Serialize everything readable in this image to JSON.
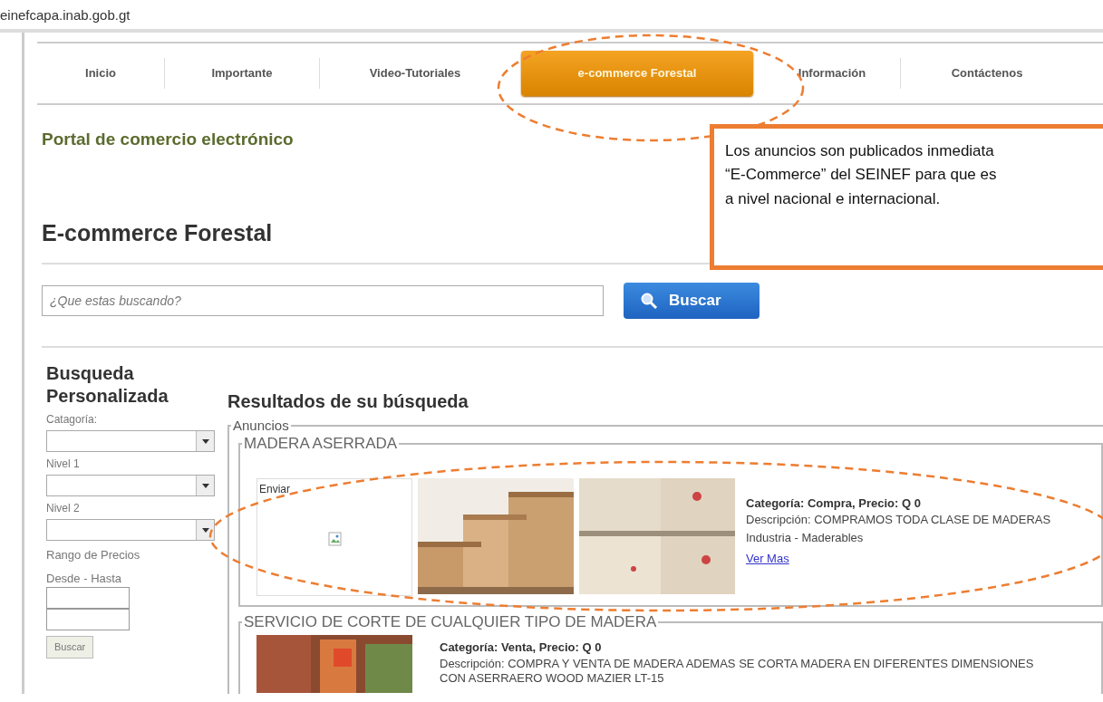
{
  "address_bar": {
    "url": "einefcapa.inab.gob.gt"
  },
  "nav": {
    "tabs": [
      {
        "label": "Inicio",
        "selected": false
      },
      {
        "label": "Importante",
        "selected": false
      },
      {
        "label": "Video-Tutoriales",
        "selected": false
      },
      {
        "label": "e-commerce Forestal",
        "selected": true
      },
      {
        "label": "Información",
        "selected": false
      },
      {
        "label": "Contáctenos",
        "selected": false
      }
    ]
  },
  "portal_title": "Portal de comercio electrónico",
  "page_title": "E-commerce Forestal",
  "search": {
    "placeholder": "¿Que estas buscando?",
    "button": "Buscar"
  },
  "filters": {
    "title": "Busqueda Personalizada",
    "items": [
      {
        "kind": "select",
        "label": "Catagoría:"
      },
      {
        "kind": "select",
        "label": "Nivel 1"
      },
      {
        "kind": "select",
        "label": "Nivel 2"
      },
      {
        "kind": "label",
        "text": "Rango de Precios"
      },
      {
        "kind": "label",
        "text": "Desde - Hasta"
      },
      {
        "kind": "input"
      },
      {
        "kind": "input"
      },
      {
        "kind": "button",
        "label": "Buscar"
      }
    ]
  },
  "results": {
    "title": "Resultados de su búsqueda",
    "group_label": "Anuncios",
    "listings": [
      {
        "title": "MADERA ASERRADA",
        "images": [
          {
            "kind": "broken",
            "alt": "Enviar"
          },
          {
            "kind": "picture"
          },
          {
            "kind": "picture"
          }
        ],
        "category": "Categoría: Compra, Precio: Q 0",
        "description": "Descripción: COMPRAMOS TODA CLASE DE MADERAS",
        "industry": "Industria - Maderables",
        "link": "Ver Mas"
      },
      {
        "title": "SERVICIO DE CORTE DE CUALQUIER TIPO DE MADERA",
        "images": [
          {
            "kind": "picture"
          }
        ],
        "category": "Categoría: Venta, Precio: Q 0",
        "description": "Descripción: COMPRA Y VENTA DE MADERA ADEMAS SE CORTA MADERA EN DIFERENTES DIMENSIONES CON ASERRAERO WOOD MAZIER LT-15"
      }
    ]
  },
  "annotations": [
    {
      "kind": "ellipse"
    },
    {
      "kind": "ellipse"
    },
    {
      "kind": "callout",
      "lines": [
        "Los anuncios son publicados inmediata",
        "“E-Commerce” del SEINEF para que es",
        "a nivel nacional e internacional."
      ]
    }
  ]
}
